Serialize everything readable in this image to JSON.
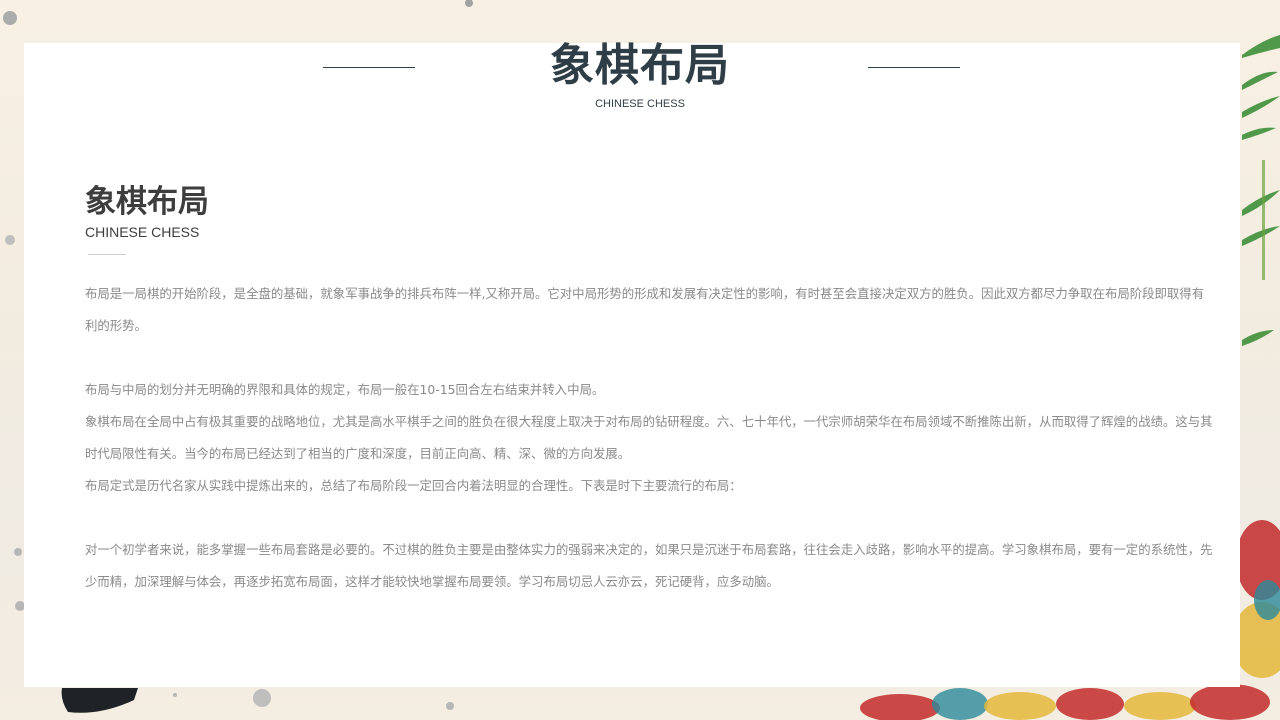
{
  "header": {
    "title": "象棋布局",
    "subtitle": "CHINESE CHESS"
  },
  "section": {
    "title": "象棋布局",
    "subtitle": "CHINESE CHESS"
  },
  "paragraphs": [
    "布局是一局棋的开始阶段，是全盘的基础，就象军事战争的排兵布阵一样,又称开局。它对中局形势的形成和发展有决定性的影响，有时甚至会直接决定双方的胜负。因此双方都尽力争取在布局阶段即取得有利的形势。",
    "布局与中局的划分并无明确的界限和具体的规定，布局一般在10-15回合左右结束并转入中局。",
    "象棋布局在全局中占有极其重要的战略地位，尤其是高水平棋手之间的胜负在很大程度上取决于对布局的钻研程度。六、七十年代，一代宗师胡荣华在布局领域不断推陈出新，从而取得了辉煌的战绩。这与其时代局限性有关。当今的布局已经达到了相当的广度和深度，目前正向高、精、深、微的方向发展。",
    "布局定式是历代名家从实践中提炼出来的，总结了布局阶段一定回合内着法明显的合理性。下表是时下主要流行的布局：",
    "对一个初学者来说，能多掌握一些布局套路是必要的。不过棋的胜负主要是由整体实力的强弱来决定的，如果只是沉迷于布局套路，往往会走入歧路，影响水平的提高。学习象棋布局，要有一定的系统性，先少而精，加深理解与体会，再逐步拓宽布局面，这样才能较快地掌握布局要领。学习布局切忌人云亦云，死记硬背，应多动脑。"
  ],
  "colors": {
    "title": "#2f3e46",
    "body_text": "#8a8a8a",
    "card": "#ffffff"
  }
}
